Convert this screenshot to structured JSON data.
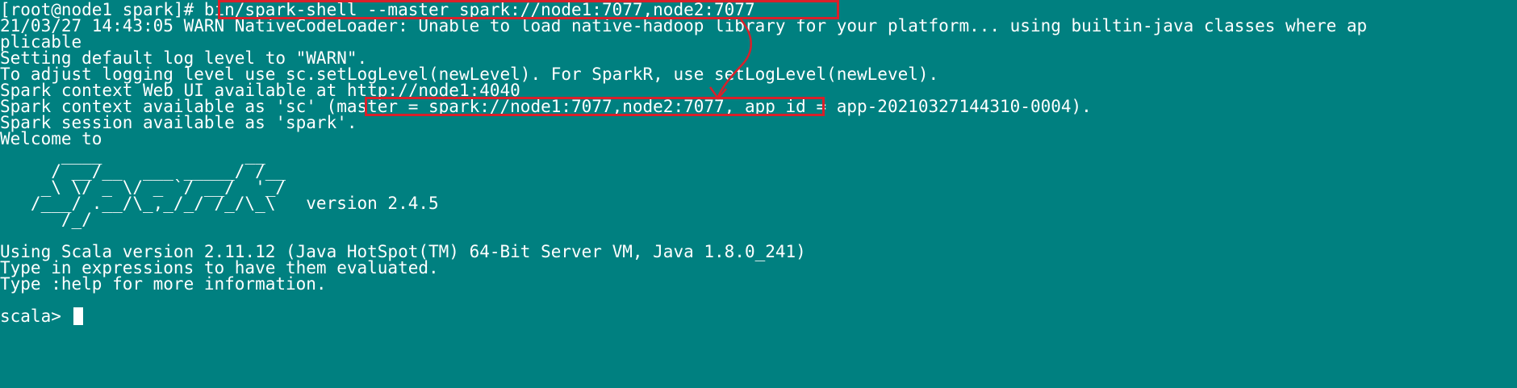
{
  "terminal": {
    "background": "#008080",
    "text_color": "#ffffff",
    "annotation_color": "#d9202a",
    "lines": {
      "command": "[root@node1 spark]# bin/spark-shell --master spark://node1:7077,node2:7077",
      "warn_1": "21/03/27 14:43:05 WARN NativeCodeLoader: Unable to load native-hadoop library for your platform... using builtin-java classes where ap",
      "warn_2": "plicable",
      "log_level": "Setting default log level to \"WARN\".",
      "adjust": "To adjust logging level use sc.setLogLevel(newLevel). For SparkR, use setLogLevel(newLevel).",
      "webui": "Spark context Web UI available at http://node1:4040",
      "context": "Spark context available as 'sc' (master = spark://node1:7077,node2:7077, app id = app-20210327144310-0004).",
      "session": "Spark session available as 'spark'.",
      "welcome": "Welcome to",
      "scala_version": "Using Scala version 2.11.12 (Java HotSpot(TM) 64-Bit Server VM, Java 1.8.0_241)",
      "type_expr": "Type in expressions to have them evaluated.",
      "type_help": "Type :help for more information.",
      "prompt": "scala> "
    },
    "logo": {
      "row1": "      ____              __",
      "row2": "     / __/__  ___ _____/ /__",
      "row3": "    _\\ \\/ _ \\/ _ `/ __/  '_/",
      "row4": "   /___/ .__/\\_,_/_/ /_/\\_\\   version 2.4.5",
      "row5": "      /_/"
    }
  }
}
